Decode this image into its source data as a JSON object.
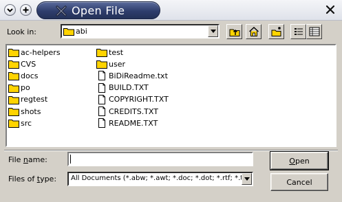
{
  "window": {
    "title": "Open File",
    "icon": "abiword-x-icon"
  },
  "toolbar": {
    "look_in_label": "Look in:",
    "look_in_value": "abi",
    "buttons": [
      "up-one-level-icon",
      "home-icon",
      "new-folder-icon",
      "list-view-icon",
      "detail-view-icon"
    ]
  },
  "files": {
    "col1": [
      {
        "name": "ac-helpers",
        "type": "folder"
      },
      {
        "name": "CVS",
        "type": "folder"
      },
      {
        "name": "docs",
        "type": "folder"
      },
      {
        "name": "po",
        "type": "folder"
      },
      {
        "name": "regtest",
        "type": "folder"
      },
      {
        "name": "shots",
        "type": "folder"
      },
      {
        "name": "src",
        "type": "folder"
      }
    ],
    "col2": [
      {
        "name": "test",
        "type": "folder"
      },
      {
        "name": "user",
        "type": "folder"
      },
      {
        "name": "BiDiReadme.txt",
        "type": "file"
      },
      {
        "name": "BUILD.TXT",
        "type": "file"
      },
      {
        "name": "COPYRIGHT.TXT",
        "type": "file"
      },
      {
        "name": "CREDITS.TXT",
        "type": "file"
      },
      {
        "name": "README.TXT",
        "type": "file"
      }
    ]
  },
  "form": {
    "file_name_label_pre": "File ",
    "file_name_label_u": "n",
    "file_name_label_post": "ame:",
    "file_name_value": "",
    "file_type_label_pre": "Files of ",
    "file_type_label_u": "t",
    "file_type_label_post": "ype:",
    "file_type_value": "All Documents (*.abw; *.awt; *.doc; *.dot; *.rtf; *.tx"
  },
  "buttons": {
    "open_u": "O",
    "open_rest": "pen",
    "cancel": "Cancel"
  }
}
